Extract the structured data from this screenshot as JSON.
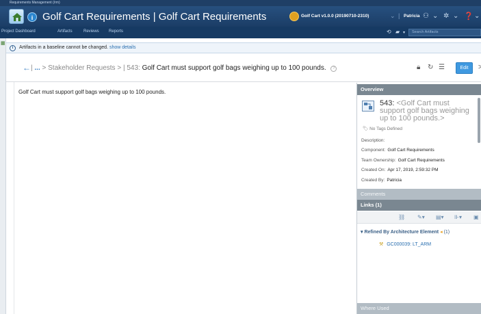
{
  "app": {
    "name": "Requirements Management (/rm)",
    "project_title": "Golf Cart Requirements | Golf Cart Requirements",
    "baseline": "Golf Cart v1.0.0 (20190710-2310)",
    "user": "Patricia"
  },
  "nav": {
    "items": [
      "Project Dashboard",
      "Artifacts",
      "Reviews",
      "Reports"
    ],
    "search_placeholder": "Search Artifacts"
  },
  "notice": {
    "text": "Artifacts in a baseline cannot be changed.",
    "link": "show details"
  },
  "breadcrumb": {
    "ellipsis": "...",
    "parent": "Stakeholder Requests",
    "sep": ">",
    "id": "543:",
    "title": "Golf Cart must support golf bags weighing up to 100 pounds."
  },
  "toolbar": {
    "edit_label": "Edit"
  },
  "main": {
    "body_text": "Golf Cart must support golf bags weighing up to 100 pounds."
  },
  "overview": {
    "header": "Overview",
    "id": "543:",
    "title_rest": "<Golf Cart must support golf bags weighing up to 100 pounds.>",
    "tags": "No Tags Defined",
    "description_label": "Description:",
    "component_label": "Component:",
    "component_value": "Golf Cart Requirements",
    "team_label": "Team Ownership:",
    "team_value": "Golf Cart Requirements",
    "created_on_label": "Created On:",
    "created_on_value": "Apr 17, 2019, 2:59:32 PM",
    "created_by_label": "Created By:",
    "created_by_value": "Patricia"
  },
  "comments": {
    "header": "Comments"
  },
  "links": {
    "header": "Links (1)",
    "group_label": "Refined By Architecture Element",
    "group_count": "(1)",
    "items": [
      {
        "label": "GC000039: LT_ARM"
      }
    ]
  },
  "where_used": {
    "header": "Where Used"
  }
}
